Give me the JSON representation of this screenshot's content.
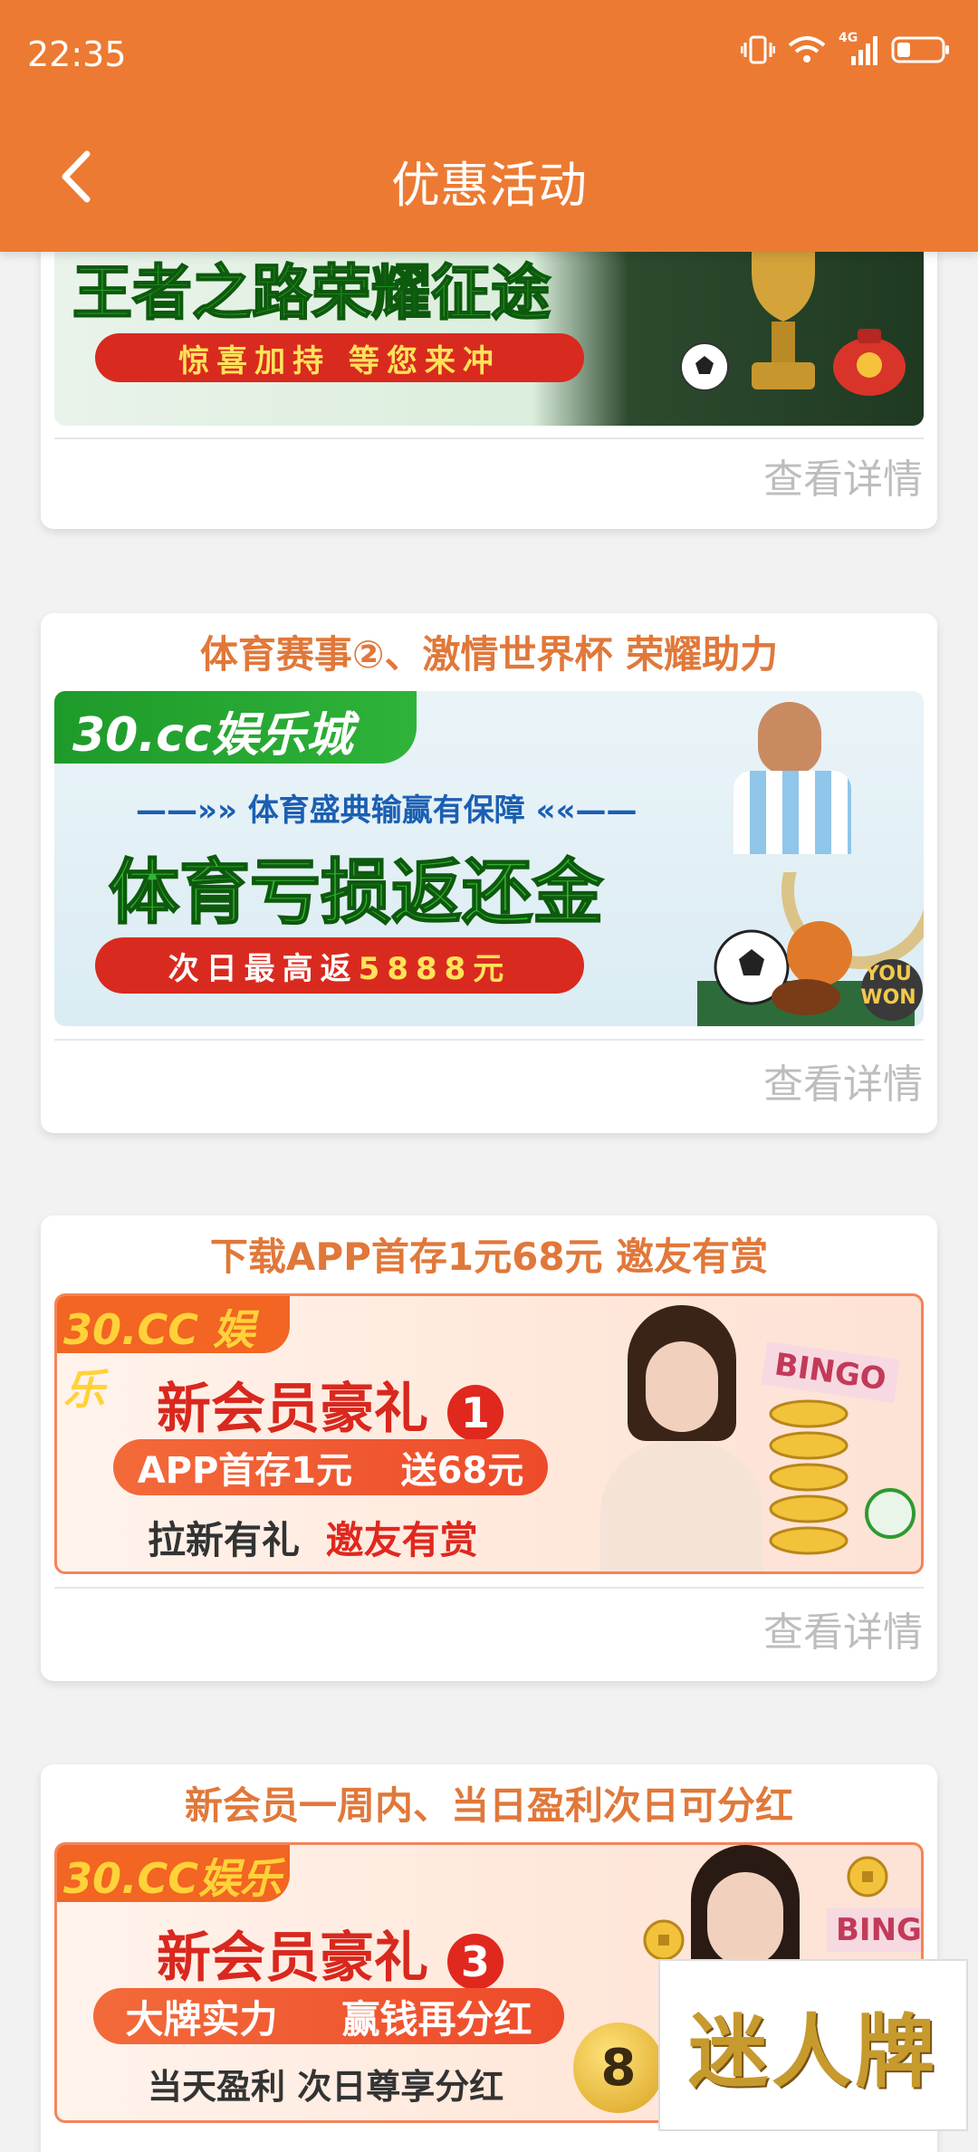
{
  "status_bar": {
    "time": "22:35",
    "network": "4G"
  },
  "header": {
    "title": "优惠活动"
  },
  "cards": [
    {
      "title": "",
      "banner": {
        "headline": "王者之路荣耀征途",
        "sub": "惊喜加持  等您来冲"
      },
      "detail": "查看详情"
    },
    {
      "title": "体育赛事②、激情世界杯 荣耀助力",
      "banner": {
        "brand": "30.cc娱乐城",
        "tagline": "——»» 体育盛典输赢有保障 ««——",
        "headline": "体育亏损返还金",
        "sub_prefix": "次日最高返",
        "sub_amount": "5888元",
        "corner": "YOU WON"
      },
      "detail": "查看详情"
    },
    {
      "title": "下载APP首存1元68元 邀友有赏",
      "banner": {
        "brand": "30.CC 娱乐",
        "headline": "新会员豪礼",
        "number": "1",
        "pill_left": "APP首存1元",
        "pill_right": "送68元",
        "line_a": "拉新有礼",
        "line_b": "邀友有赏",
        "decor": "BINGO"
      },
      "detail": "查看详情"
    },
    {
      "title": "新会员一周内、当日盈利次日可分红",
      "banner": {
        "brand": "30.CC娱乐",
        "headline": "新会员豪礼",
        "number": "3",
        "pill_left": "大牌实力",
        "pill_right": "赢钱再分红",
        "line": "当天盈利 次日尊享分红",
        "decor": "BINGO",
        "ball": "8"
      },
      "detail": ""
    }
  ],
  "watermark": "迷人牌",
  "colors": {
    "header": "#ec7a32",
    "title": "#e0783a",
    "detail": "#bdbdbd",
    "green": "#2e9a2e",
    "red": "#d92a1f"
  }
}
